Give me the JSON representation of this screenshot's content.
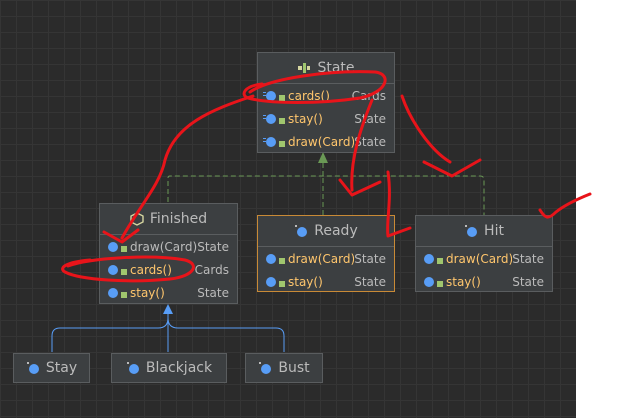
{
  "classes": {
    "state": {
      "name": "State",
      "methods": [
        {
          "name": "cards()",
          "type": "Cards"
        },
        {
          "name": "stay()",
          "type": "State"
        },
        {
          "name": "draw(Card)",
          "type": "State"
        }
      ]
    },
    "finished": {
      "name": "Finished",
      "methods": [
        {
          "name": "draw(Card)",
          "type": "State"
        },
        {
          "name": "cards()",
          "type": "Cards"
        },
        {
          "name": "stay()",
          "type": "State"
        }
      ]
    },
    "ready": {
      "name": "Ready",
      "methods": [
        {
          "name": "draw(Card)",
          "type": "State"
        },
        {
          "name": "stay()",
          "type": "State"
        }
      ]
    },
    "hit": {
      "name": "Hit",
      "methods": [
        {
          "name": "draw(Card)",
          "type": "State"
        },
        {
          "name": "stay()",
          "type": "State"
        }
      ]
    },
    "stay": {
      "name": "Stay"
    },
    "blackjack": {
      "name": "Blackjack"
    },
    "bust": {
      "name": "Bust"
    }
  },
  "colors": {
    "interface_arrow": "#6a9955",
    "inherit_arrow": "#589df6",
    "annotation": "#e8141a",
    "method": "#ffc66d"
  }
}
